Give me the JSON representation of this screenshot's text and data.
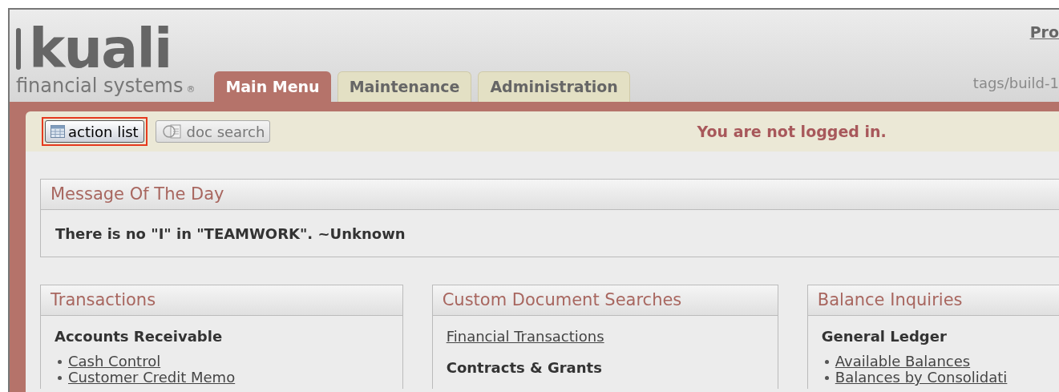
{
  "logo": {
    "wordmark": "kuali",
    "tagline": "financial systems",
    "registered": "®"
  },
  "header_link": "Pro",
  "build": "tags/build-1",
  "tabs": [
    {
      "label": "Main Menu",
      "selected": true
    },
    {
      "label": "Maintenance",
      "selected": false
    },
    {
      "label": "Administration",
      "selected": false
    }
  ],
  "toolbar": {
    "buttons": [
      {
        "label": "action list",
        "kind": "list",
        "selected": true
      },
      {
        "label": "doc search",
        "kind": "search",
        "selected": false
      }
    ],
    "login_status": "You are not logged in."
  },
  "message_of_the_day": {
    "title": "Message Of The Day",
    "text": "There is no \"I\" in \"TEAMWORK\". ~Unknown"
  },
  "panels": [
    {
      "title": "Transactions",
      "children": [
        {
          "kind": "heading",
          "text": "Accounts Receivable"
        },
        {
          "kind": "bullet",
          "text": "Cash Control"
        },
        {
          "kind": "bullet",
          "text": "Customer Credit Memo"
        }
      ]
    },
    {
      "title": "Custom Document Searches",
      "children": [
        {
          "kind": "link",
          "text": "Financial Transactions"
        },
        {
          "kind": "heading",
          "text": "Contracts & Grants"
        }
      ]
    },
    {
      "title": "Balance Inquiries",
      "children": [
        {
          "kind": "heading",
          "text": "General Ledger"
        },
        {
          "kind": "bullet",
          "text": "Available Balances"
        },
        {
          "kind": "bullet",
          "text": "Balances by Consolidati"
        }
      ]
    }
  ]
}
